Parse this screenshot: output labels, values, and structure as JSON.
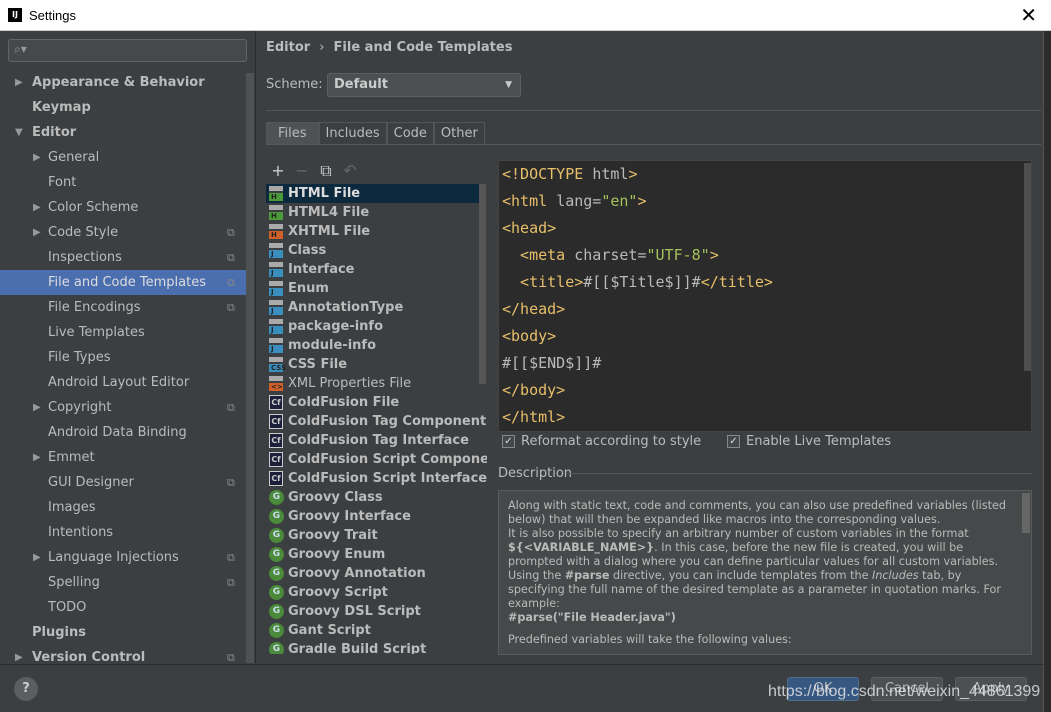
{
  "window": {
    "title": "Settings",
    "close": "✕"
  },
  "sidebar": {
    "search_placeholder": "",
    "items": [
      {
        "label": "Appearance & Behavior",
        "level": 0,
        "expand": "▶"
      },
      {
        "label": "Keymap",
        "level": 0
      },
      {
        "label": "Editor",
        "level": 0,
        "expand": "▼"
      },
      {
        "label": "General",
        "level": 1,
        "expand": "▶"
      },
      {
        "label": "Font",
        "level": 1
      },
      {
        "label": "Color Scheme",
        "level": 1,
        "expand": "▶"
      },
      {
        "label": "Code Style",
        "level": 1,
        "expand": "▶",
        "copy": true
      },
      {
        "label": "Inspections",
        "level": 1,
        "copy": true
      },
      {
        "label": "File and Code Templates",
        "level": 1,
        "copy": true,
        "selected": true
      },
      {
        "label": "File Encodings",
        "level": 1,
        "copy": true
      },
      {
        "label": "Live Templates",
        "level": 1
      },
      {
        "label": "File Types",
        "level": 1
      },
      {
        "label": "Android Layout Editor",
        "level": 1
      },
      {
        "label": "Copyright",
        "level": 1,
        "expand": "▶",
        "copy": true
      },
      {
        "label": "Android Data Binding",
        "level": 1
      },
      {
        "label": "Emmet",
        "level": 1,
        "expand": "▶"
      },
      {
        "label": "GUI Designer",
        "level": 1,
        "copy": true
      },
      {
        "label": "Images",
        "level": 1
      },
      {
        "label": "Intentions",
        "level": 1
      },
      {
        "label": "Language Injections",
        "level": 1,
        "expand": "▶",
        "copy": true
      },
      {
        "label": "Spelling",
        "level": 1,
        "copy": true
      },
      {
        "label": "TODO",
        "level": 1
      },
      {
        "label": "Plugins",
        "level": 0
      },
      {
        "label": "Version Control",
        "level": 0,
        "expand": "▶",
        "copy": true
      }
    ]
  },
  "breadcrumb": {
    "parent": "Editor",
    "sep": "›",
    "current": "File and Code Templates"
  },
  "scheme": {
    "label": "Scheme:",
    "value": "Default"
  },
  "tabs": [
    "Files",
    "Includes",
    "Code",
    "Other"
  ],
  "toolbar": {
    "add": "+",
    "remove": "−",
    "copy": "⧉",
    "reset": "↶"
  },
  "templates": [
    {
      "name": "HTML File",
      "icon": "file",
      "badge": "H",
      "color": "#4a9a3a",
      "selected": true
    },
    {
      "name": "HTML4 File",
      "icon": "file",
      "badge": "H",
      "color": "#4a9a3a"
    },
    {
      "name": "XHTML File",
      "icon": "file",
      "badge": "H",
      "color": "#d0602a"
    },
    {
      "name": "Class",
      "icon": "file",
      "badge": "J",
      "color": "#3a8fbf"
    },
    {
      "name": "Interface",
      "icon": "file",
      "badge": "J",
      "color": "#3a8fbf"
    },
    {
      "name": "Enum",
      "icon": "file",
      "badge": "J",
      "color": "#3a8fbf"
    },
    {
      "name": "AnnotationType",
      "icon": "file",
      "badge": "J",
      "color": "#3a8fbf"
    },
    {
      "name": "package-info",
      "icon": "file",
      "badge": "J",
      "color": "#3a8fbf"
    },
    {
      "name": "module-info",
      "icon": "file",
      "badge": "J",
      "color": "#3a8fbf"
    },
    {
      "name": "CSS File",
      "icon": "file",
      "badge": "CSS",
      "color": "#3a8fbf"
    },
    {
      "name": "XML Properties File",
      "icon": "file",
      "badge": "<>",
      "color": "#d0602a",
      "plain": true
    },
    {
      "name": "ColdFusion File",
      "icon": "cf",
      "badge": "Cf"
    },
    {
      "name": "ColdFusion Tag Component",
      "icon": "cf",
      "badge": "Cf"
    },
    {
      "name": "ColdFusion Tag Interface",
      "icon": "cf",
      "badge": "Cf"
    },
    {
      "name": "ColdFusion Script Component",
      "icon": "cf",
      "badge": "Cf"
    },
    {
      "name": "ColdFusion Script Interface",
      "icon": "cf",
      "badge": "Cf"
    },
    {
      "name": "Groovy Class",
      "icon": "g",
      "badge": "G"
    },
    {
      "name": "Groovy Interface",
      "icon": "g",
      "badge": "G"
    },
    {
      "name": "Groovy Trait",
      "icon": "g",
      "badge": "G"
    },
    {
      "name": "Groovy Enum",
      "icon": "g",
      "badge": "G"
    },
    {
      "name": "Groovy Annotation",
      "icon": "g",
      "badge": "G"
    },
    {
      "name": "Groovy Script",
      "icon": "g",
      "badge": "G"
    },
    {
      "name": "Groovy DSL Script",
      "icon": "g",
      "badge": "G"
    },
    {
      "name": "Gant Script",
      "icon": "g",
      "badge": "G"
    },
    {
      "name": "Gradle Build Script",
      "icon": "g",
      "badge": "G"
    }
  ],
  "editor": {
    "lines": [
      [
        [
          "tg",
          "<!DOCTYPE "
        ],
        [
          "at",
          "html"
        ],
        [
          "tg",
          ">"
        ]
      ],
      [
        [
          "tg",
          "<html "
        ],
        [
          "at",
          "lang="
        ],
        [
          "st",
          "\"en\""
        ],
        [
          "tg",
          ">"
        ]
      ],
      [
        [
          "tg",
          "<head>"
        ]
      ],
      [
        [
          "tg",
          "  <meta "
        ],
        [
          "at",
          "charset="
        ],
        [
          "st",
          "\"UTF-8\""
        ],
        [
          "tg",
          ">"
        ]
      ],
      [
        [
          "tg",
          "  <title>"
        ],
        [
          "at",
          "#[[$Title$]]#"
        ],
        [
          "tg",
          "</title>"
        ]
      ],
      [
        [
          "tg",
          "</head>"
        ]
      ],
      [
        [
          "tg",
          "<body>"
        ]
      ],
      [
        [
          "at",
          "#[[$END$]]#"
        ]
      ],
      [
        [
          "tg",
          "</body>"
        ]
      ],
      [
        [
          "tg",
          "</html>"
        ]
      ]
    ]
  },
  "options": {
    "reformat": {
      "label": "Reformat according to style",
      "checked": true
    },
    "live": {
      "label": "Enable Live Templates",
      "checked": true
    }
  },
  "description": {
    "label": "Description",
    "p1": "Along with static text, code and comments, you can also use predefined variables (listed below) that will then be expanded like macros into the corresponding values.",
    "p2a": "It is also possible to specify an arbitrary number of custom variables in the format ",
    "p2b": "${<VARIABLE_NAME>}",
    "p2c": ". In this case, before the new file is created, you will be prompted with a dialog where you can define particular values for all custom variables.",
    "p3a": "Using the ",
    "p3b": "#parse",
    "p3c": " directive, you can include templates from the ",
    "p3d": "Includes",
    "p3e": " tab, by specifying the full name of the desired template as a parameter in quotation marks. For example:",
    "p4": "#parse(\"File Header.java\")",
    "p5": "Predefined variables will take the following values:"
  },
  "footer": {
    "help": "?",
    "ok": "OK",
    "cancel": "Cancel",
    "apply": "Apply",
    "watermark": "https://blog.csdn.net/weixin_44861399"
  },
  "colors": {
    "selection": "#4b6eaf",
    "list_selection": "#0d293e",
    "ok_button": "#365880",
    "editor_bg": "#2b2b2b"
  }
}
